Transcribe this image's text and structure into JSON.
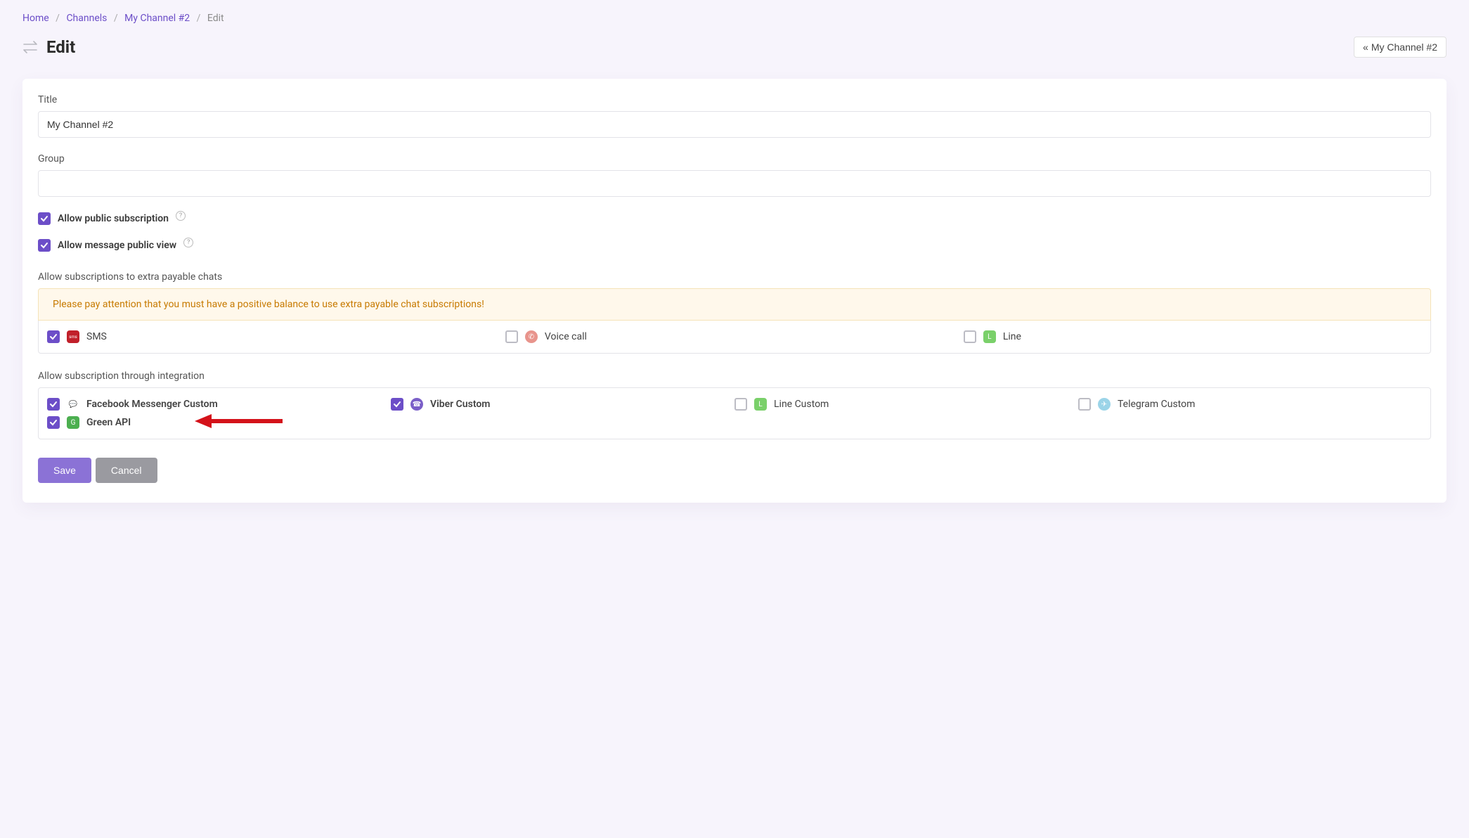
{
  "breadcrumb": {
    "home": "Home",
    "channels": "Channels",
    "channel": "My Channel #2",
    "current": "Edit"
  },
  "page_title": "Edit",
  "back_button": "My Channel #2",
  "form": {
    "title_label": "Title",
    "title_value": "My Channel #2",
    "group_label": "Group",
    "group_value": ""
  },
  "checkboxes": {
    "public_sub": {
      "label": "Allow public subscription",
      "checked": true
    },
    "public_view": {
      "label": "Allow message public view",
      "checked": true
    }
  },
  "extra_section": {
    "label": "Allow subscriptions to extra payable chats",
    "warning": "Please pay attention that you must have a positive balance to use extra payable chat subscriptions!",
    "options": [
      {
        "label": "SMS",
        "checked": true,
        "icon_bg": "#c1202a",
        "icon_txt": "sms"
      },
      {
        "label": "Voice call",
        "checked": false,
        "icon_bg": "#e07a72",
        "icon_txt": "✆"
      },
      {
        "label": "Line",
        "checked": false,
        "icon_bg": "#7ad06a",
        "icon_txt": "L"
      }
    ]
  },
  "integration_section": {
    "label": "Allow subscription through integration",
    "options": [
      {
        "label": "Facebook Messenger Custom",
        "checked": true,
        "icon_bg": "#e8e0ff",
        "icon_txt": "💬"
      },
      {
        "label": "Viber Custom",
        "checked": true,
        "icon_bg": "#7a5ec8",
        "icon_txt": "☎"
      },
      {
        "label": "Line Custom",
        "checked": false,
        "icon_bg": "#7ad06a",
        "icon_txt": "L"
      },
      {
        "label": "Telegram Custom",
        "checked": false,
        "icon_bg": "#9bd4e8",
        "icon_txt": "✈"
      },
      {
        "label": "Green API",
        "checked": true,
        "icon_bg": "#4caf50",
        "icon_txt": "G"
      }
    ]
  },
  "buttons": {
    "save": "Save",
    "cancel": "Cancel"
  }
}
